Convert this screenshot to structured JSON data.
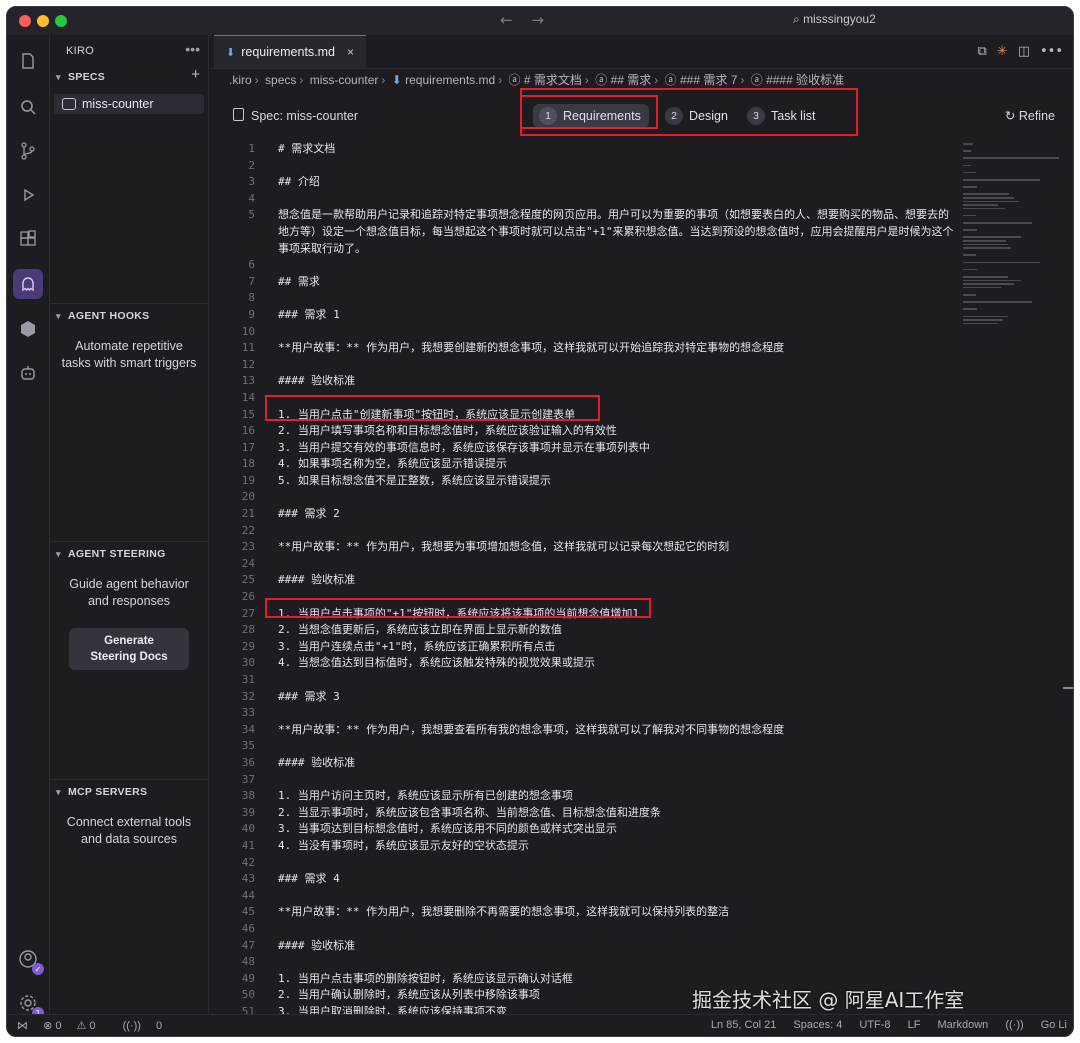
{
  "titlebar": {
    "search": "misssingyou2",
    "back": "←",
    "forward": "→"
  },
  "sidebar": {
    "title": "KIRO",
    "more": "•••",
    "specs": {
      "title": "SPECS",
      "add": "+",
      "items": [
        {
          "label": "miss-counter"
        }
      ]
    },
    "agent_hooks": {
      "title": "AGENT HOOKS",
      "desc": "Automate repetitive tasks with smart triggers"
    },
    "agent_steering": {
      "title": "AGENT STEERING",
      "desc": "Guide agent behavior and responses",
      "button": "Generate Steering Docs"
    },
    "mcp_servers": {
      "title": "MCP SERVERS",
      "desc": "Connect external tools and data sources"
    }
  },
  "editor": {
    "tab": {
      "label": "requirements.md",
      "close": "×"
    },
    "breadcrumb": [
      ".kiro",
      "specs",
      "miss-counter",
      "requirements.md",
      "# 需求文档",
      "## 需求",
      "### 需求 7",
      "#### 验收标准"
    ],
    "spec_label": "Spec: miss-counter",
    "steps": [
      {
        "num": "1",
        "label": "Requirements"
      },
      {
        "num": "2",
        "label": "Design"
      },
      {
        "num": "3",
        "label": "Task list"
      }
    ],
    "refine": "Refine",
    "lines": [
      {
        "n": "1",
        "t": "# 需求文档"
      },
      {
        "n": "2",
        "t": ""
      },
      {
        "n": "3",
        "t": "## 介绍"
      },
      {
        "n": "4",
        "t": ""
      },
      {
        "n": "5",
        "t": "想念值是一款帮助用户记录和追踪对特定事项想念程度的网页应用。用户可以为重要的事项（如想要表白的人、想要购买的物品、想要去的地方等）设定一个想念值目标，每当想起这个事项时就可以点击\"+1\"来累积想念值。当达到预设的想念值时，应用会提醒用户是时候为这个事项采取行动了。"
      },
      {
        "n": "6",
        "t": ""
      },
      {
        "n": "7",
        "t": "## 需求"
      },
      {
        "n": "8",
        "t": ""
      },
      {
        "n": "9",
        "t": "### 需求 1"
      },
      {
        "n": "10",
        "t": ""
      },
      {
        "n": "11",
        "t": "**用户故事：** 作为用户，我想要创建新的想念事项，这样我就可以开始追踪我对特定事物的想念程度"
      },
      {
        "n": "12",
        "t": ""
      },
      {
        "n": "13",
        "t": "#### 验收标准"
      },
      {
        "n": "14",
        "t": ""
      },
      {
        "n": "15",
        "t": "1. 当用户点击\"创建新事项\"按钮时，系统应该显示创建表单"
      },
      {
        "n": "16",
        "t": "2. 当用户填写事项名称和目标想念值时，系统应该验证输入的有效性"
      },
      {
        "n": "17",
        "t": "3. 当用户提交有效的事项信息时，系统应该保存该事项并显示在事项列表中"
      },
      {
        "n": "18",
        "t": "4. 如果事项名称为空，系统应该显示错误提示"
      },
      {
        "n": "19",
        "t": "5. 如果目标想念值不是正整数，系统应该显示错误提示"
      },
      {
        "n": "20",
        "t": ""
      },
      {
        "n": "21",
        "t": "### 需求 2"
      },
      {
        "n": "22",
        "t": ""
      },
      {
        "n": "23",
        "t": "**用户故事：** 作为用户，我想要为事项增加想念值，这样我就可以记录每次想起它的时刻"
      },
      {
        "n": "24",
        "t": ""
      },
      {
        "n": "25",
        "t": "#### 验收标准"
      },
      {
        "n": "26",
        "t": ""
      },
      {
        "n": "27",
        "t": "1. 当用户点击事项的\"+1\"按钮时，系统应该将该事项的当前想念值增加1"
      },
      {
        "n": "28",
        "t": "2. 当想念值更新后，系统应该立即在界面上显示新的数值"
      },
      {
        "n": "29",
        "t": "3. 当用户连续点击\"+1\"时，系统应该正确累积所有点击"
      },
      {
        "n": "30",
        "t": "4. 当想念值达到目标值时，系统应该触发特殊的视觉效果或提示"
      },
      {
        "n": "31",
        "t": ""
      },
      {
        "n": "32",
        "t": "### 需求 3"
      },
      {
        "n": "33",
        "t": ""
      },
      {
        "n": "34",
        "t": "**用户故事：** 作为用户，我想要查看所有我的想念事项，这样我就可以了解我对不同事物的想念程度"
      },
      {
        "n": "35",
        "t": ""
      },
      {
        "n": "36",
        "t": "#### 验收标准"
      },
      {
        "n": "37",
        "t": ""
      },
      {
        "n": "38",
        "t": "1. 当用户访问主页时，系统应该显示所有已创建的想念事项"
      },
      {
        "n": "39",
        "t": "2. 当显示事项时，系统应该包含事项名称、当前想念值、目标想念值和进度条"
      },
      {
        "n": "40",
        "t": "3. 当事项达到目标想念值时，系统应该用不同的颜色或样式突出显示"
      },
      {
        "n": "41",
        "t": "4. 当没有事项时，系统应该显示友好的空状态提示"
      },
      {
        "n": "42",
        "t": ""
      },
      {
        "n": "43",
        "t": "### 需求 4"
      },
      {
        "n": "44",
        "t": ""
      },
      {
        "n": "45",
        "t": "**用户故事：** 作为用户，我想要删除不再需要的想念事项，这样我就可以保持列表的整洁"
      },
      {
        "n": "46",
        "t": ""
      },
      {
        "n": "47",
        "t": "#### 验收标准"
      },
      {
        "n": "48",
        "t": ""
      },
      {
        "n": "49",
        "t": "1. 当用户点击事项的删除按钮时，系统应该显示确认对话框"
      },
      {
        "n": "50",
        "t": "2. 当用户确认删除时，系统应该从列表中移除该事项"
      },
      {
        "n": "51",
        "t": "3. 当用户取消删除时，系统应该保持事项不变"
      }
    ]
  },
  "statusbar": {
    "errors": "⊗ 0",
    "warnings": "⚠ 0",
    "ports": "0",
    "position": "Ln 85, Col 21",
    "spaces": "Spaces: 4",
    "encoding": "UTF-8",
    "eol": "LF",
    "language": "Markdown",
    "golive": "Go Li"
  },
  "watermark": "掘金技术社区 @ 阿星AI工作室",
  "colors": {
    "accent": "#7c5cdb",
    "highlight_box": "#e0212b",
    "bold_markdown": "#a88cf0"
  }
}
